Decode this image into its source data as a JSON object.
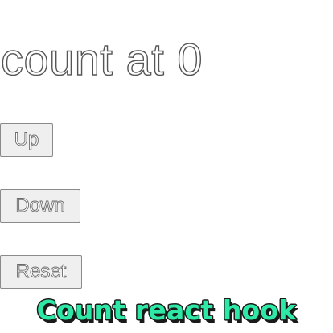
{
  "counter": {
    "heading": "count at 0"
  },
  "buttons": {
    "up_label": "Up",
    "down_label": "Down",
    "reset_label": "Reset"
  },
  "caption": {
    "text": "Count react hook",
    "color": "#2ee8a6"
  }
}
